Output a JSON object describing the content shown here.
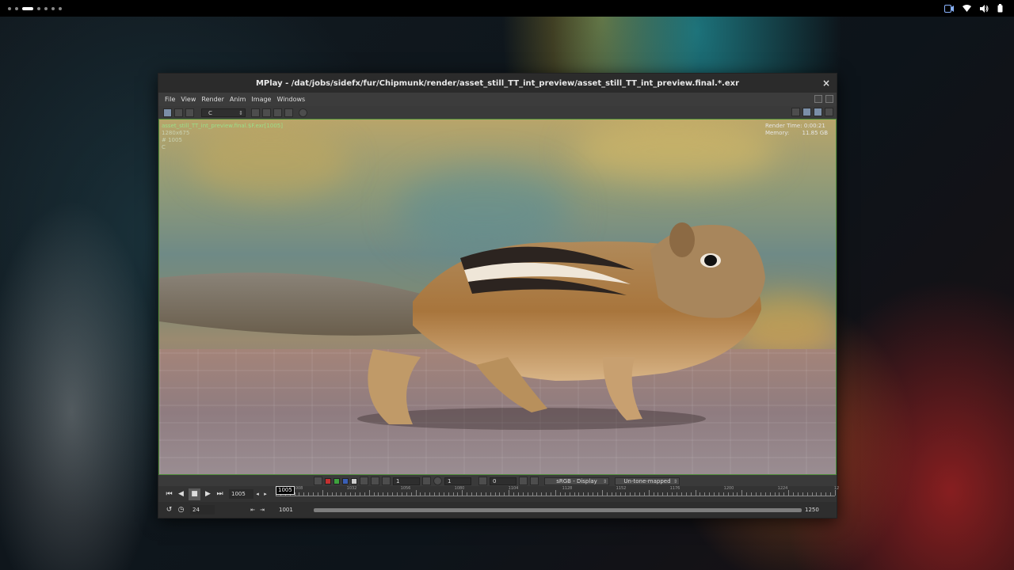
{
  "window": {
    "title": "MPlay - /dat/jobs/sidefx/fur/Chipmunk/render/asset_still_TT_int_preview/asset_still_TT_int_preview.final.*.exr",
    "close_symbol": "×"
  },
  "menu": [
    "File",
    "View",
    "Render",
    "Anim",
    "Image",
    "Windows"
  ],
  "toolbar": {
    "channel": "C"
  },
  "viewport": {
    "overlay_left": {
      "filename": "asset_still_TT_int_preview.final.$F.exr[1005]",
      "resolution": "1280x675",
      "frame": "# 1005",
      "channel": "C"
    },
    "overlay_right": {
      "render_time_label": "Render Time:",
      "render_time": "0:00:21",
      "memory_label": "Memory:",
      "memory": "11.85 GB"
    }
  },
  "display_controls": {
    "gamma": "1",
    "exposure": "1",
    "offset": "0",
    "colorspace": "sRGB - Display",
    "tone_map": "Un-tone-mapped"
  },
  "playbar": {
    "current_frame": "1005",
    "timeline_frame": "1005",
    "fps": "24",
    "range_start": "1001",
    "range_end": "1250",
    "tick_labels": [
      "1008",
      "1032",
      "1056",
      "1080",
      "1104",
      "1128",
      "1152",
      "1176",
      "1200",
      "1224",
      "12"
    ]
  }
}
